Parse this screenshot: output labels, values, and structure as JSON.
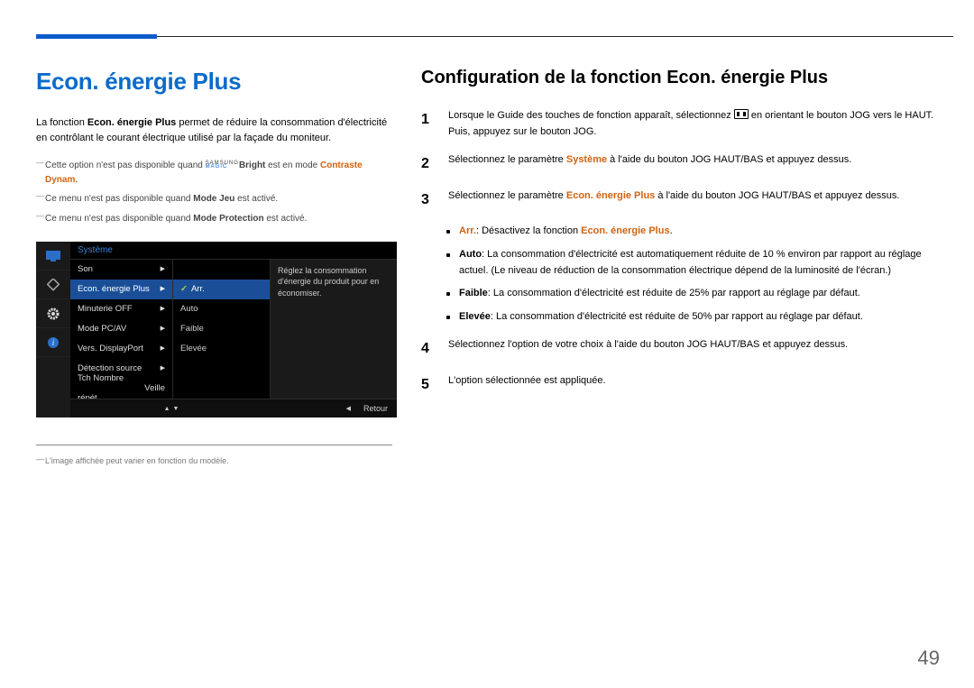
{
  "header": {
    "title": "Econ. énergie Plus"
  },
  "intro": {
    "prefix": "La fonction ",
    "term": "Econ. énergie Plus",
    "suffix": " permet de réduire la consommation d'électricité en contrôlant le courant électrique utilisé par la façade du moniteur."
  },
  "notes": {
    "n1a": "Cette option n'est pas disponible quand ",
    "n1magic_top": "SAMSUNG",
    "n1magic_bot": "MAGIC",
    "n1b": "Bright",
    "n1c": " est en mode ",
    "n1d": "Contraste Dynam.",
    "n2a": "Ce menu n'est pas disponible quand ",
    "n2b": "Mode Jeu",
    "n2c": " est activé.",
    "n3a": "Ce menu n'est pas disponible quand ",
    "n3b": "Mode Protection",
    "n3c": " est activé."
  },
  "osd": {
    "header": "Système",
    "rows": [
      "Son",
      "Econ. énergie Plus",
      "Minuterie OFF",
      "Mode PC/AV",
      "Vers. DisplayPort",
      "Détection source",
      "Tch Nombre répét."
    ],
    "row_right_6": "Veille",
    "sub": [
      "Arr.",
      "Auto",
      "Faible",
      "Elevée"
    ],
    "help": "Réglez la consommation d'énergie du produit pour en économiser.",
    "retour": "Retour"
  },
  "foot": "L'image affichée peut varier en fonction du modèle.",
  "right": {
    "title": "Configuration de la fonction Econ. énergie Plus",
    "step1a": "Lorsque le Guide des touches de fonction apparaît, sélectionnez ",
    "step1b": " en orientant le bouton JOG vers le HAUT. Puis, appuyez sur le bouton JOG.",
    "step2a": "Sélectionnez le paramètre ",
    "step2term": "Système",
    "step2b": " à l'aide du bouton JOG HAUT/BAS et appuyez dessus.",
    "step3a": "Sélectionnez le paramètre ",
    "step3term": "Econ. énergie Plus",
    "step3b": " à l'aide du bouton JOG HAUT/BAS et appuyez dessus.",
    "b1term": "Arr.",
    "b1a": ": Désactivez la fonction ",
    "b1term2": "Econ. énergie Plus",
    "b1b": ".",
    "b2term": "Auto",
    "b2a": ": La consommation d'électricité est automatiquement réduite de 10 % environ par rapport au réglage actuel. (Le niveau de réduction de la consommation électrique dépend de la luminosité de l'écran.)",
    "b3term": "Faible",
    "b3a": ": La consommation d'électricité est réduite de 25% par rapport au réglage par défaut.",
    "b4term": "Elevée",
    "b4a": ": La consommation d'électricité est réduite de 50% par rapport au réglage par défaut.",
    "step4": "Sélectionnez l'option de votre choix à l'aide du bouton JOG HAUT/BAS et appuyez dessus.",
    "step5": "L'option sélectionnée est appliquée."
  },
  "num": {
    "s1": "1",
    "s2": "2",
    "s3": "3",
    "s4": "4",
    "s5": "5"
  },
  "page_number": "49",
  "chart_data": {
    "type": "table",
    "description": "OSD menu state",
    "menu": {
      "title": "Système",
      "items": [
        {
          "label": "Son"
        },
        {
          "label": "Econ. énergie Plus",
          "selected": true,
          "value": "Arr.",
          "options": [
            "Arr.",
            "Auto",
            "Faible",
            "Elevée"
          ]
        },
        {
          "label": "Minuterie OFF"
        },
        {
          "label": "Mode PC/AV"
        },
        {
          "label": "Vers. DisplayPort"
        },
        {
          "label": "Détection source"
        },
        {
          "label": "Tch Nombre répét.",
          "value": "Veille"
        }
      ],
      "help": "Réglez la consommation d'énergie du produit pour en économiser.",
      "footer_action": "Retour"
    }
  }
}
